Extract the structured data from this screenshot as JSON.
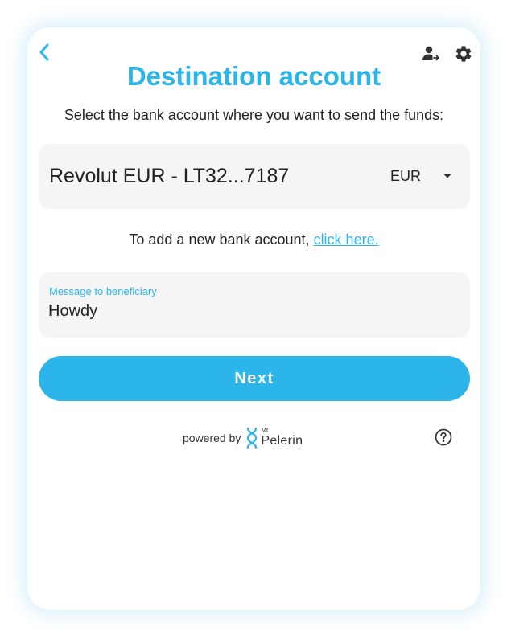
{
  "header": {
    "title": "Destination account",
    "back_icon": "chevron-left-icon",
    "user_icon": "user-switch-icon",
    "settings_icon": "gear-icon"
  },
  "subtitle": "Select the bank account where you want to send the funds:",
  "bank_select": {
    "value": "Revolut EUR - LT32...7187",
    "currency": "EUR"
  },
  "add_account": {
    "text": "To add a new bank account, ",
    "link": "click here."
  },
  "message_field": {
    "label": "Message to beneficiary",
    "value": "Howdy"
  },
  "next_button": {
    "label": "Next"
  },
  "footer": {
    "powered_by": "powered by",
    "brand_prefix": "Mt",
    "brand_name": "Pelerin",
    "help_icon": "help-circle-icon"
  },
  "colors": {
    "accent": "#2cb5ea",
    "field_bg": "#f5f5f5",
    "text": "#222222"
  }
}
